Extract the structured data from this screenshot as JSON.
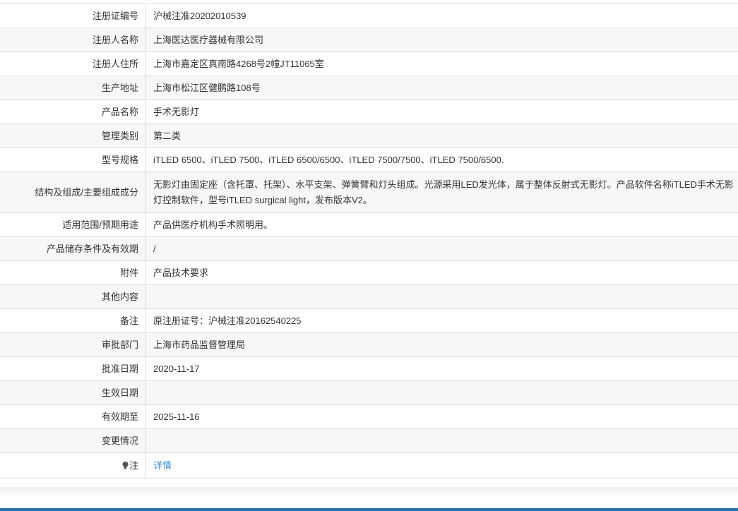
{
  "rows": [
    {
      "label": "注册证编号",
      "value": "沪械注准20202010539"
    },
    {
      "label": "注册人名称",
      "value": "上海医达医疗器械有限公司"
    },
    {
      "label": "注册人住所",
      "value": "上海市嘉定区真南路4268号2幢JT11065室"
    },
    {
      "label": "生产地址",
      "value": "上海市松江区健鹏路108号"
    },
    {
      "label": "产品名称",
      "value": "手术无影灯"
    },
    {
      "label": "管理类别",
      "value": "第二类"
    },
    {
      "label": "型号规格",
      "value": "iTLED 6500、iTLED 7500、iTLED 6500/6500、iTLED 7500/7500、iTLED 7500/6500."
    },
    {
      "label": "结构及组成/主要组成成分",
      "value": "无影灯由固定座（含托罩、托架）、水平支架、弹簧臂和灯头组成。光源采用LED发光体，属于整体反射式无影灯。产品软件名称iTLED手术无影灯控制软件，型号iTLED surgical light，发布版本V2。"
    },
    {
      "label": "适用范围/预期用途",
      "value": "产品供医疗机构手术照明用。"
    },
    {
      "label": "产品储存条件及有效期",
      "value": "/"
    },
    {
      "label": "附件",
      "value": "产品技术要求"
    },
    {
      "label": "其他内容",
      "value": ""
    },
    {
      "label": "备注",
      "value": "原注册证号：沪械注准20162540225"
    },
    {
      "label": "审批部门",
      "value": "上海市药品监督管理局"
    },
    {
      "label": "批准日期",
      "value": "2020-11-17"
    },
    {
      "label": "生效日期",
      "value": ""
    },
    {
      "label": "有效期至",
      "value": "2025-11-16"
    },
    {
      "label": "变更情况",
      "value": ""
    }
  ],
  "note": {
    "label": "注",
    "link": "详情"
  },
  "colors": {
    "link": "#3a8ee6",
    "border": "#dddddd",
    "stripe": "#f7f7f7",
    "bottom_bar": "#2a6fa8"
  }
}
